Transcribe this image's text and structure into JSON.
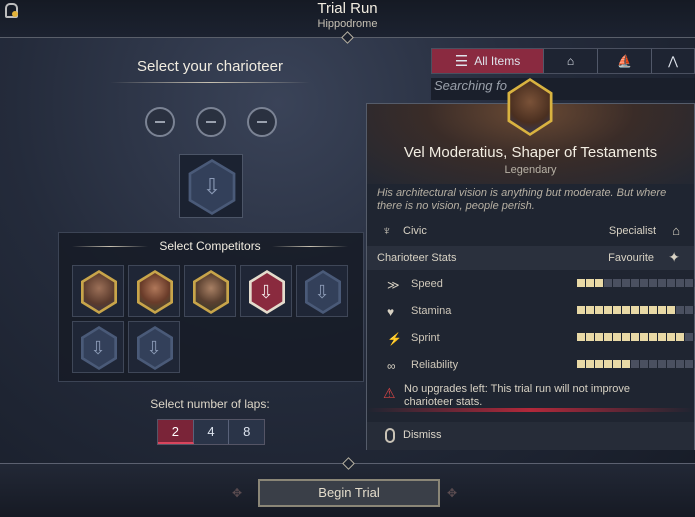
{
  "header": {
    "title": "Trial Run",
    "subtitle": "Hippodrome"
  },
  "left": {
    "select_charioteer_label": "Select your charioteer",
    "select_competitors_label": "Select Competitors",
    "laps_label": "Select number of laps:",
    "laps": [
      {
        "label": "2",
        "active": true
      },
      {
        "label": "4",
        "active": false
      },
      {
        "label": "8",
        "active": false
      }
    ]
  },
  "filter": {
    "tabs": [
      {
        "label": "All Items",
        "icon": "list-icon",
        "active": true
      },
      {
        "label": "",
        "icon": "building-icon",
        "active": false
      },
      {
        "label": "",
        "icon": "ship-icon",
        "active": false
      },
      {
        "label": "",
        "icon": "tent-icon",
        "active": false
      }
    ],
    "search_placeholder": "Searching fo"
  },
  "tooltip": {
    "name": "Vel Moderatius, Shaper of Testaments",
    "rarity": "Legendary",
    "description": "His architectural vision is anything but moderate. But where there is no vision, people perish.",
    "class_label": "Civic",
    "role_label": "Specialist",
    "stats_heading": "Charioteer Stats",
    "favourite_label": "Favourite",
    "stats": [
      {
        "label": "Speed",
        "icon": "speed-icon",
        "value": 3,
        "max": 15
      },
      {
        "label": "Stamina",
        "icon": "heart-icon",
        "value": 11,
        "max": 15
      },
      {
        "label": "Sprint",
        "icon": "sprint-icon",
        "value": 12,
        "max": 15
      },
      {
        "label": "Reliability",
        "icon": "reliability-icon",
        "value": 6,
        "max": 15
      }
    ],
    "warning": "No upgrades left: This trial run will not improve charioteer stats.",
    "dismiss_label": "Dismiss"
  },
  "footer": {
    "begin_label": "Begin Trial"
  }
}
